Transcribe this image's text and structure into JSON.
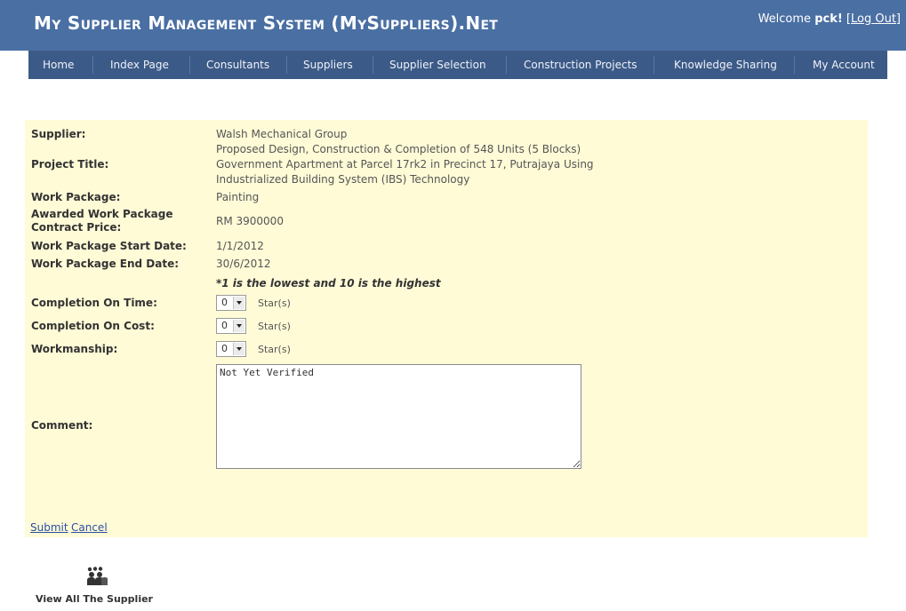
{
  "header": {
    "app_title": "My Supplier Management System (MySuppliers).Net",
    "welcome_prefix": "Welcome",
    "username": "pck!",
    "logout_label": "Log Out"
  },
  "nav": {
    "items": [
      "Home",
      "Index Page",
      "Consultants",
      "Suppliers",
      "Supplier Selection",
      "Construction Projects",
      "Knowledge Sharing",
      "My Account"
    ]
  },
  "form": {
    "supplier_label": "Supplier:",
    "supplier_value": "Walsh Mechanical Group",
    "project_title_label": "Project Title:",
    "project_title_lines": [
      "Proposed Design, Construction & Completion of 548 Units (5 Blocks)",
      "Government Apartment at Parcel 17rk2 in Precinct 17, Putrajaya Using",
      "Industrialized Building System (IBS) Technology"
    ],
    "work_package_label": "Work Package:",
    "work_package_value": "Painting",
    "awarded_price_label_1": "Awarded Work Package",
    "awarded_price_label_2": "Contract Price:",
    "awarded_price_value": "RM 3900000",
    "start_date_label": "Work Package Start Date:",
    "start_date_value": "1/1/2012",
    "end_date_label": "Work Package End Date:",
    "end_date_value": "30/6/2012",
    "rating_note": "*1 is the lowest and 10 is the highest",
    "ratings": [
      {
        "label": "Completion On Time:",
        "value": "0",
        "unit": "Star(s)"
      },
      {
        "label": "Completion On Cost:",
        "value": "0",
        "unit": "Star(s)"
      },
      {
        "label": "Workmanship:",
        "value": "0",
        "unit": "Star(s)"
      }
    ],
    "comment_label": "Comment:",
    "comment_value": "Not Yet Verified",
    "submit_label": "Submit",
    "cancel_label": "Cancel"
  },
  "footer": {
    "view_all_icon": "people-icon",
    "view_all_label": "View All The Supplier"
  }
}
